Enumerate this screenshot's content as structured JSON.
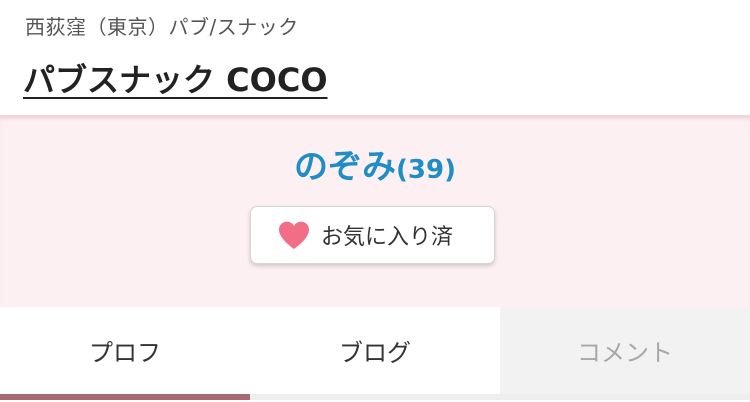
{
  "header": {
    "breadcrumb": "西荻窪（東京）パブ/スナック",
    "shop_name": "パブスナック COCO"
  },
  "profile": {
    "name": "のぞみ",
    "age": "(39)",
    "favorite_button": {
      "label": "お気に入り済",
      "icon": "heart-icon",
      "icon_color": "#f26d86"
    }
  },
  "tabs": {
    "items": [
      {
        "label": "プロフ",
        "active": true
      },
      {
        "label": "ブログ",
        "active": false
      },
      {
        "label": "コメント",
        "active": false,
        "disabled_look": true
      }
    ],
    "active_indicator_color": "#a86a6f"
  },
  "colors": {
    "accent_name": "#1f8dc6",
    "profile_bg": "#fdf0f3"
  }
}
